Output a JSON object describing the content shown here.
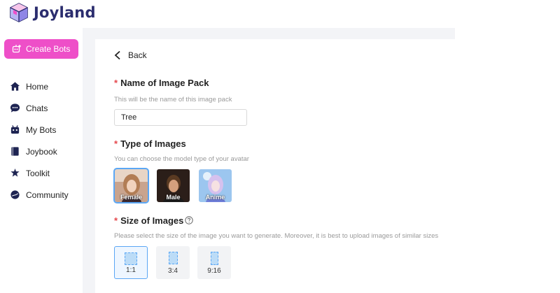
{
  "app": {
    "name": "Joyland"
  },
  "sidebar": {
    "create_button": "Create Bots",
    "items": [
      {
        "label": "Home",
        "icon": "home-icon"
      },
      {
        "label": "Chats",
        "icon": "chat-bubble-icon"
      },
      {
        "label": "My Bots",
        "icon": "robot-icon"
      },
      {
        "label": "Joybook",
        "icon": "book-icon"
      },
      {
        "label": "Toolkit",
        "icon": "toolkit-icon"
      },
      {
        "label": "Community",
        "icon": "community-icon"
      }
    ]
  },
  "form": {
    "back_label": "Back",
    "name_section": {
      "required_mark": "*",
      "title": "Name of Image Pack",
      "hint": "This will be the name of this image pack",
      "value": "Tree"
    },
    "type_section": {
      "required_mark": "*",
      "title": "Type of Images",
      "hint": "You can choose the model type of your avatar",
      "options": [
        "Female",
        "Male",
        "Anime"
      ],
      "selected": "Female"
    },
    "size_section": {
      "required_mark": "*",
      "title": "Size of Images",
      "hint": "Please select the size of the image you want to generate. Moreover, it is best to upload images of similar sizes",
      "options": [
        "1:1",
        "3:4",
        "9:16"
      ],
      "selected": "1:1"
    }
  },
  "colors": {
    "brand_pink": "#ee4fc8",
    "logo_navy": "#2b2d6e",
    "required_red": "#e5484d",
    "selected_blue": "#5ba7f5"
  }
}
